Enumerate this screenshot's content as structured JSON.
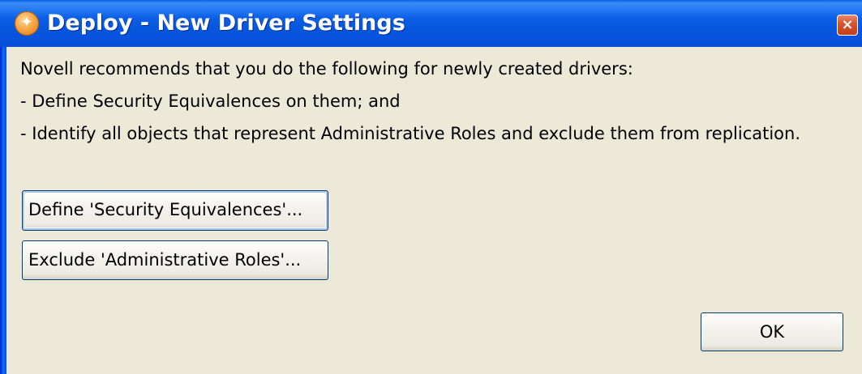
{
  "window": {
    "title": "Deploy - New Driver Settings",
    "icon": "novell-logo-icon",
    "close_glyph": "×",
    "colors": {
      "titlebar": "#0556dc",
      "face": "#ece9d8",
      "close": "#d9562e"
    }
  },
  "message": {
    "line1": "Novell recommends that you do the following for newly created drivers:",
    "line2": "- Define Security Equivalences on them; and",
    "line3": "- Identify all objects that represent Administrative Roles and exclude them from replication."
  },
  "buttons": {
    "define_label": "Define 'Security Equivalences'...",
    "exclude_label": "Exclude 'Administrative Roles'...",
    "ok_label": "OK"
  }
}
